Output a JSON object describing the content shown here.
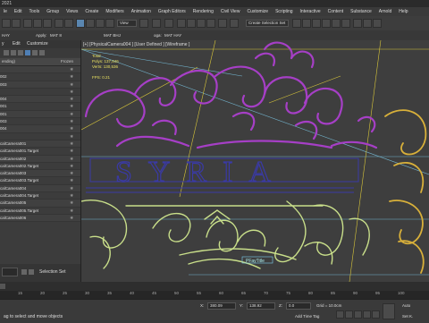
{
  "window": {
    "title": "2021"
  },
  "menu": [
    "le",
    "Edit",
    "Tools",
    "Group",
    "Views",
    "Create",
    "Modifiers",
    "Animation",
    "Graph Editors",
    "Rendering",
    "Civil View",
    "Customize",
    "Scripting",
    "Interactive",
    "Content",
    "Substance",
    "Arnold",
    "Help"
  ],
  "toolbar": {
    "view_dropdown": "View",
    "selection_set_dropdown": "Create Selection Set"
  },
  "toolbar2": {
    "left_field": "HAY",
    "apply_label": "Apply:",
    "apply_value": "MAT 8",
    "mat_value": "MAT BHJ",
    "oga_label": "oga:",
    "oga_value": "MAT HAY"
  },
  "scene_explorer": {
    "tabs": [
      "y",
      "Edit",
      "Customize"
    ],
    "header": {
      "name": "ending)",
      "frozen": "Frozen"
    },
    "rows": [
      "",
      "002",
      "003",
      "",
      "004",
      "001",
      "001",
      "003",
      "004",
      "",
      "calCamera001",
      "calCamera001.Target",
      "calCamera002",
      "calCamera002.Target",
      "calCamera003",
      "calCamera003.Target",
      "calCamera004",
      "calCamera004.Target",
      "calCamera005",
      "calCamera005.Target",
      "calCamera006"
    ],
    "selection_set_label": "Selection Set"
  },
  "viewport": {
    "label": "[+] [PhysicalCamera004 ] [User Defined ] [Wireframe ]",
    "stats": {
      "total_label": "Total",
      "polys_label": "Polys:",
      "polys_value": "137,846",
      "verts_label": "Verts:",
      "verts_value": "130,536",
      "fps_label": "FPS:",
      "fps_value": "0.21"
    },
    "lettering": "SYRIA",
    "tag": "PFayTitle",
    "colors": {
      "purple": "#a63fc6",
      "green": "#c9df8a",
      "yellow": "#d8b03a",
      "navy": "#3a3aa6",
      "cyan": "#7fd0f0"
    }
  },
  "timeline": {
    "ticks": [
      "15",
      "20",
      "25",
      "30",
      "35",
      "40",
      "45",
      "50",
      "55",
      "60",
      "65",
      "70",
      "75",
      "80",
      "85",
      "90",
      "95",
      "100"
    ]
  },
  "status": {
    "prompt": "ag to select and move objects",
    "x_label": "X:",
    "x_value": "380.09",
    "y_label": "Y:",
    "y_value": "138.92",
    "z_label": "Z:",
    "z_value": "0.0",
    "grid": "Grid = 10.0cm",
    "time_tag": "Add Time Tag",
    "auto_label": "Auto",
    "setk_label": "Set K."
  }
}
